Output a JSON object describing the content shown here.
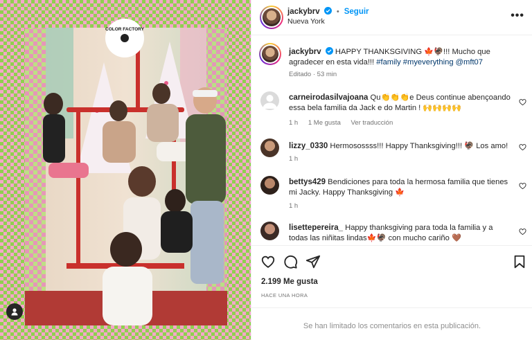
{
  "post": {
    "username": "jackybrv",
    "follow_label": "Seguir",
    "location": "Nueva York",
    "more_label": "•••",
    "photo_sign": "COLOR FACTORY"
  },
  "caption": {
    "username": "jackybrv",
    "text": "HAPPY THANKSGIVING 🍁🦃!!! Mucho que agradecer en esta vida!!!",
    "hashtags": "#family #myeverything",
    "mention": "@mft07",
    "meta": "Editado · 53 min"
  },
  "comments": [
    {
      "username": "carneirodasilvajoana",
      "text": "Qu👏👏👏e Deus continue abençoando essa bela familia da Jack e do Martin ! 🙌🙌🙌🙌",
      "time": "1 h",
      "likes": "1 Me gusta",
      "translate": "Ver traducción"
    },
    {
      "username": "lizzy_0330",
      "text": "Hermosossss!!! Happy Thanksgiving!!! 🦃 Los amo!",
      "time": "1 h"
    },
    {
      "username": "bettys429",
      "text": "Bendiciones para toda la hermosa familia que tienes mi Jacky. Happy Thanksgiving 🍁",
      "time": "1 h"
    },
    {
      "username": "lisettepereira_",
      "text": "Happy thanksgiving para toda la familia y a todas las niñitas lindas🍁🦃 con mucho cariño 🤎",
      "time": ""
    }
  ],
  "likes": "2.199 Me gusta",
  "posted_ago": "HACE UNA HORA",
  "comments_limited": "Se han limitado los comentarios en esta publicación.",
  "colors": {
    "accent": "#0095f6",
    "text": "#262626",
    "muted": "#737373",
    "tag": "#00376b"
  },
  "icons": [
    "user-tag-icon",
    "verified-badge-icon",
    "more-options-icon",
    "heart-icon",
    "comment-icon",
    "share-icon",
    "bookmark-icon"
  ]
}
